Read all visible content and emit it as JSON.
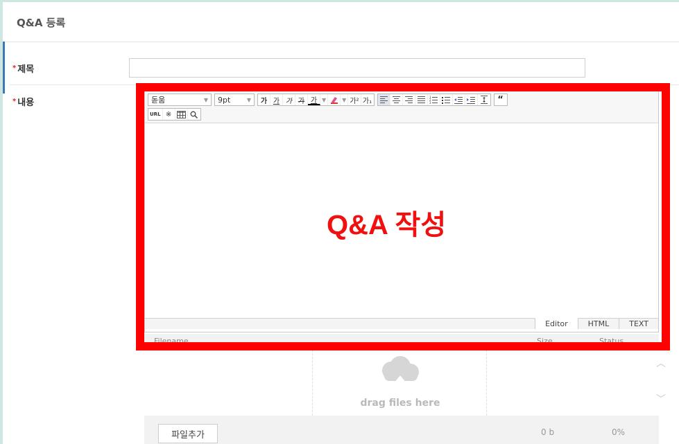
{
  "page": {
    "title": "Q&A 등록"
  },
  "form": {
    "title_label": "제목",
    "content_label": "내용",
    "required_mark": "*",
    "title_value": ""
  },
  "editor": {
    "font_select": "돋움",
    "size_select": "9pt",
    "bold": "가",
    "underline": "가",
    "italic": "가",
    "strike": "가",
    "font_color": "가",
    "superscript": "가²",
    "subscript": "가₁",
    "quote": "“",
    "url": "URL",
    "special_char": "※",
    "search": "🔍",
    "overlay_text": "Q&A 작성",
    "modes": [
      "Editor",
      "HTML",
      "TEXT"
    ],
    "active_mode": "Editor"
  },
  "upload": {
    "columns": [
      "Filename",
      "Size",
      "Status"
    ],
    "drop_text": "drag files here",
    "add_button": "파일추가",
    "total_size": "0 b",
    "progress": "0%"
  },
  "colors": {
    "highlight_frame": "#ff0000",
    "overlay_text": "#f01010",
    "accent": "#3a78b8"
  }
}
